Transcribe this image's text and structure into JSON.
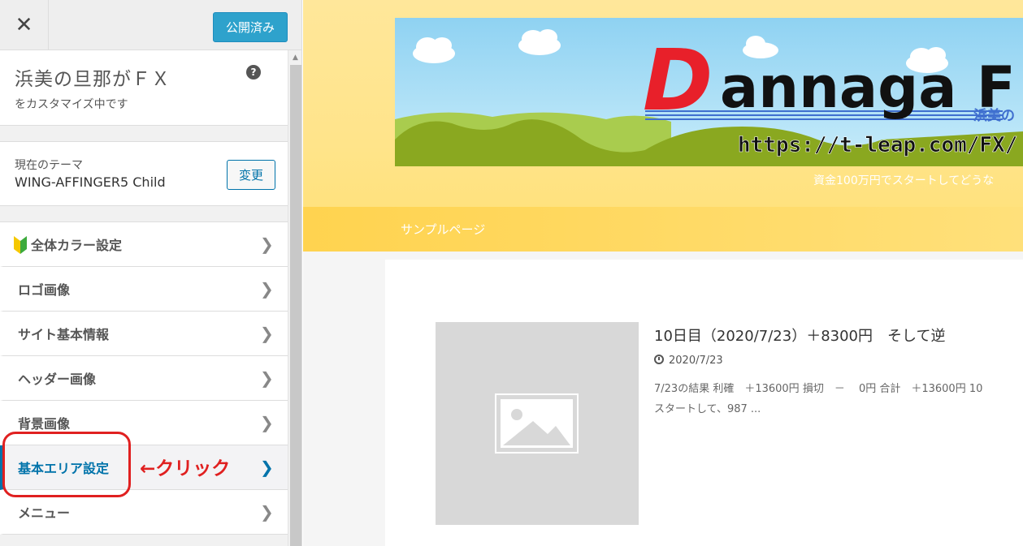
{
  "topbar": {
    "close_glyph": "✕",
    "publish_label": "公開済み"
  },
  "info": {
    "site_title": "浜美の旦那がＦＸ",
    "subtitle": "をカスタマイズ中です",
    "help_glyph": "?"
  },
  "theme": {
    "label": "現在のテーマ",
    "name": "WING-AFFINGER5 Child",
    "change_label": "変更"
  },
  "menu": [
    {
      "label": "全体カラー設定",
      "icon": "beginner-leaf-icon"
    },
    {
      "label": "ロゴ画像"
    },
    {
      "label": "サイト基本情報"
    },
    {
      "label": "ヘッダー画像"
    },
    {
      "label": "背景画像"
    },
    {
      "label": "基本エリア設定",
      "active": true
    },
    {
      "label": "メニュー"
    }
  ],
  "annotation": {
    "text": "←クリック",
    "color": "#e02020"
  },
  "preview": {
    "banner": {
      "logo_text": "Dannaga F",
      "sub_text": "浜美の",
      "url_text": "https://t-leap.com/FX/"
    },
    "catchphrase": "資金100万円でスタートしてどうな",
    "nav_items": [
      "サンプルページ"
    ],
    "post": {
      "title": "10日目（2020/7/23）＋8300円　そして逆",
      "date": "2020/7/23",
      "excerpt_line1": "7/23の結果 利確　＋13600円 損切　－　 0円 合計　＋13600円 10",
      "excerpt_line2": "スタートして、987 ..."
    }
  },
  "colors": {
    "accent": "#0073aa",
    "publish": "#2ea2cc",
    "header_yellow": "#ffe48a",
    "nav_yellow": "#ffd34f"
  }
}
